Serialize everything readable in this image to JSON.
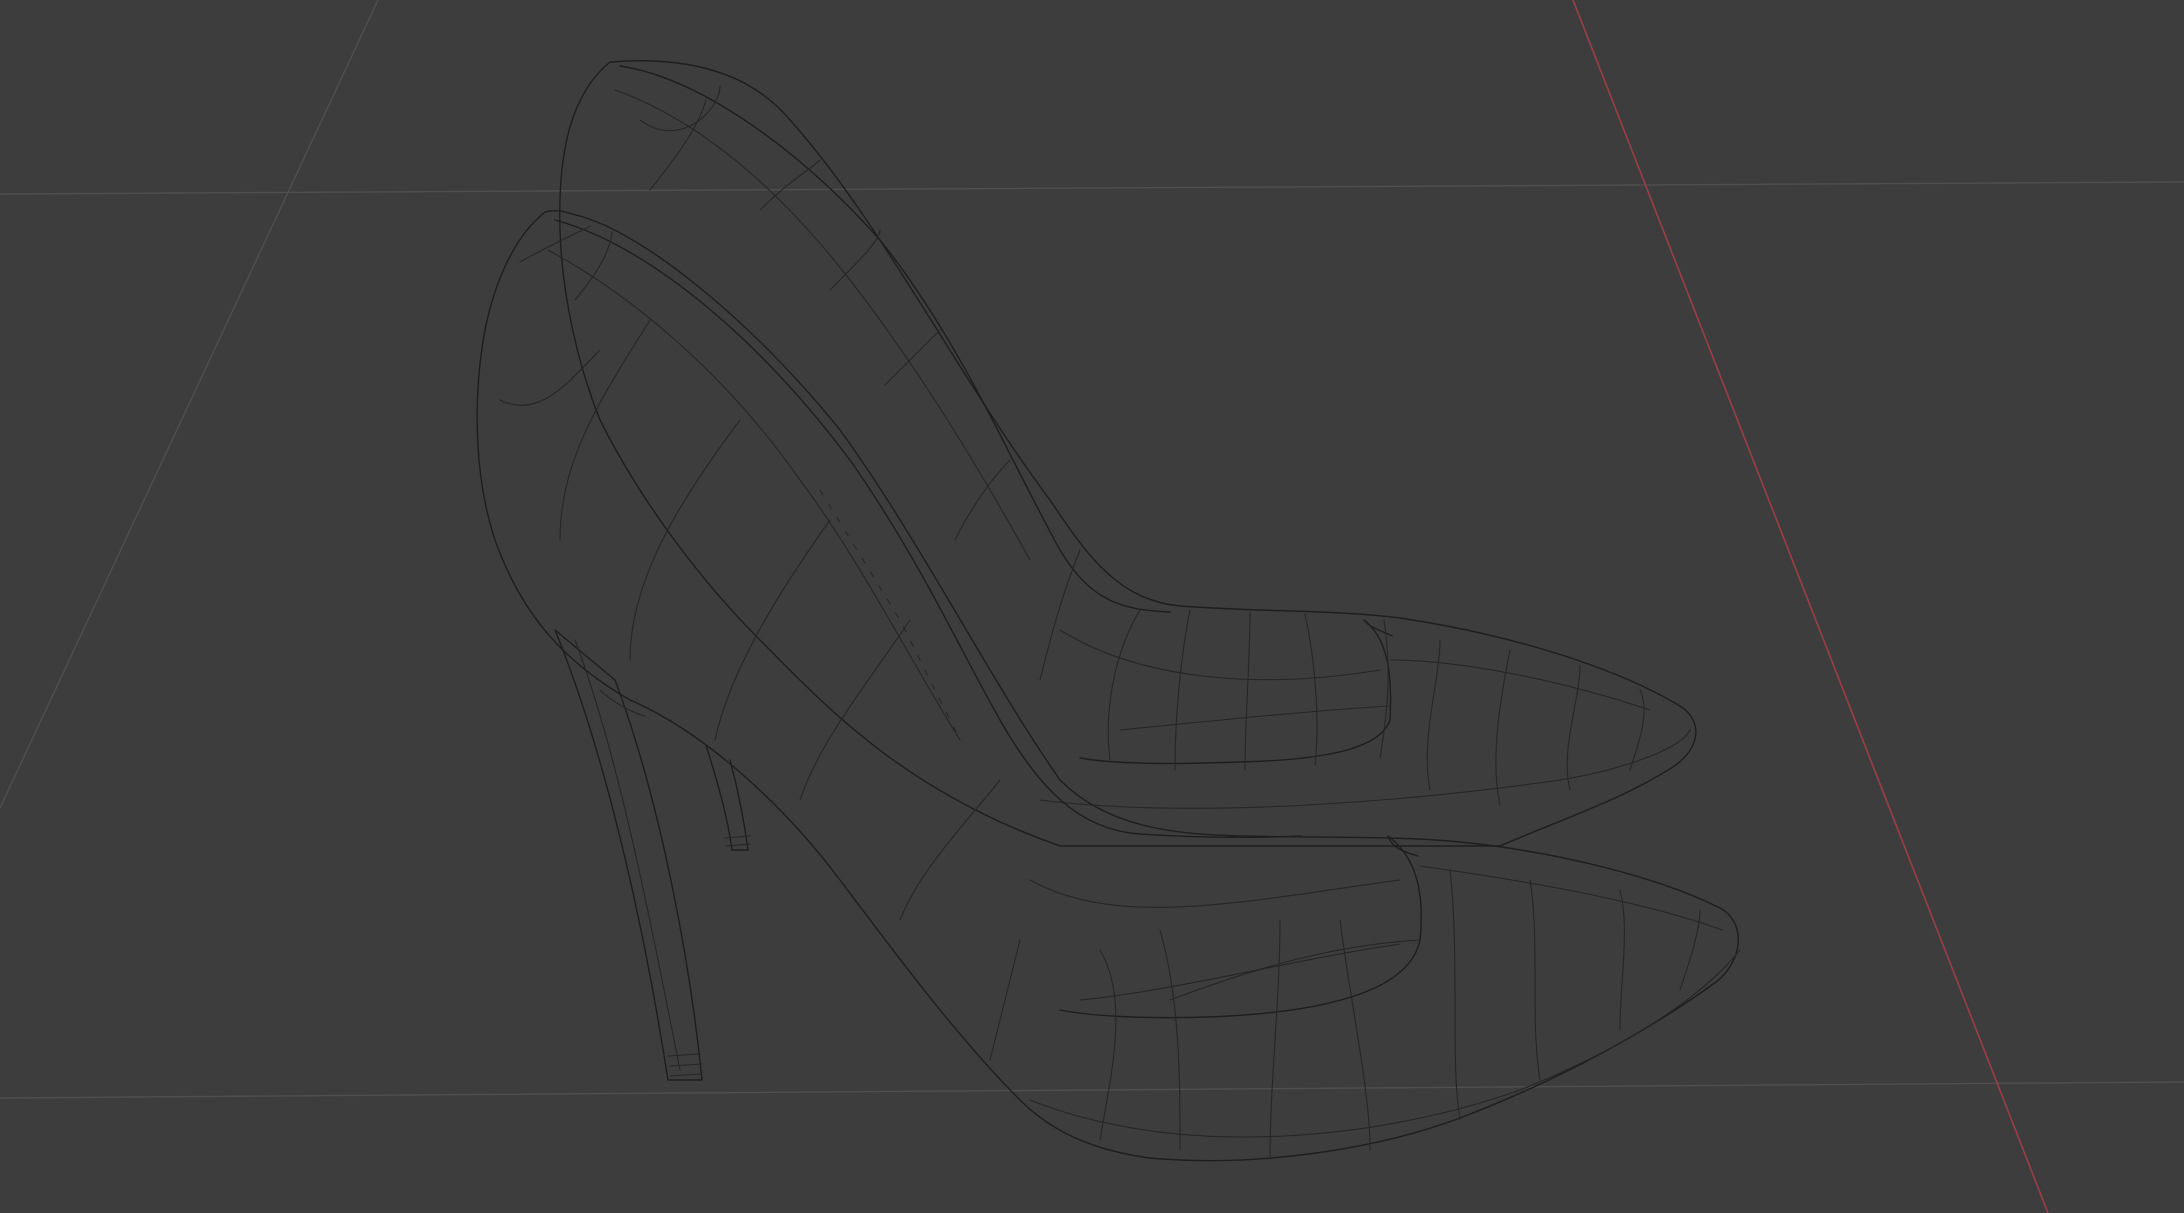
{
  "viewport": {
    "background_color": "#3d3d3d",
    "grid_color": "#4f4f4f",
    "x_axis_color": "#9b3f47",
    "wire_color": "#1e1e1e",
    "shading": "wireframe",
    "objects": [
      "left-shoe",
      "right-shoe"
    ]
  }
}
